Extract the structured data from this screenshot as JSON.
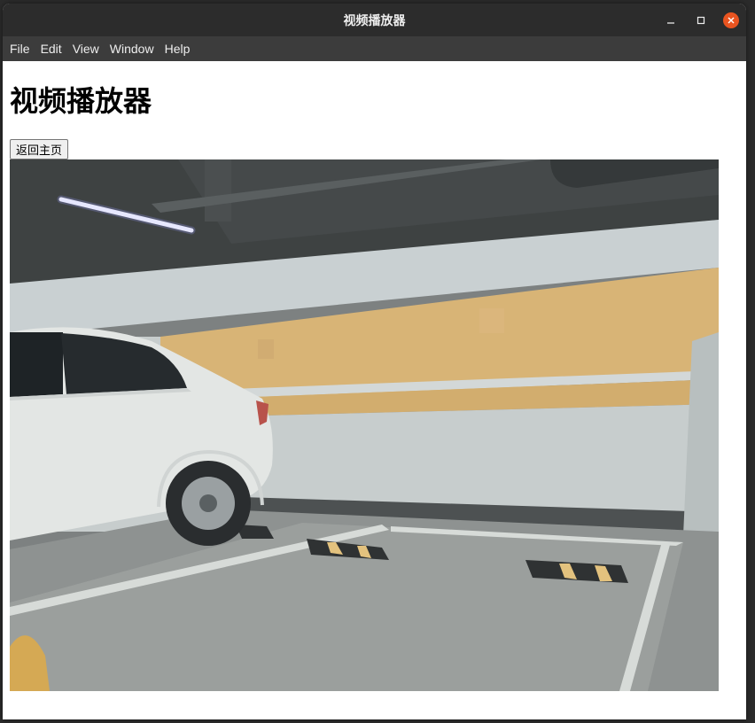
{
  "window": {
    "title": "视频播放器"
  },
  "menubar": {
    "items": [
      {
        "label": "File"
      },
      {
        "label": "Edit"
      },
      {
        "label": "View"
      },
      {
        "label": "Window"
      },
      {
        "label": "Help"
      }
    ]
  },
  "page": {
    "heading": "视频播放器",
    "back_button": "返回主页"
  },
  "colors": {
    "titlebar": "#2c2c2c",
    "menubar": "#3c3c3c",
    "close_accent": "#e95420",
    "wall_stripe": "#d8b476"
  },
  "icons": {
    "minimize": "minimize-icon",
    "maximize": "maximize-icon",
    "close": "close-icon"
  }
}
